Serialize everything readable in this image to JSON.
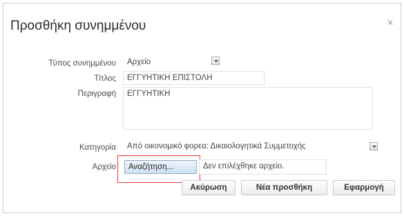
{
  "dialog": {
    "title": "Προσθήκη συνημμένου",
    "close_symbol": "×"
  },
  "form": {
    "attachment_type_label": "Τύπος συνημμένου",
    "attachment_type_value": "Αρχείο",
    "title_label": "Τίτλος",
    "title_value": "ΕΓΓΥΗΤΙΚΗ ΕΠΙΣΤΟΛΗ",
    "description_label": "Περιγραφή",
    "description_value": "ΕΓΓΥΗΤΙΚΗ",
    "category_label": "Κατηγορία",
    "category_value": "Από οικονομικό φορεα: Δικαιολογητικά Συμμετοχής",
    "file_label": "Αρχείο",
    "browse_label": "Αναζήτηση...",
    "file_status": "Δεν επιλέχθηκε αρχείο."
  },
  "buttons": {
    "cancel": "Ακύρωση",
    "new_addition": "Νέα προσθήκη",
    "apply": "Εφαρμογή"
  }
}
